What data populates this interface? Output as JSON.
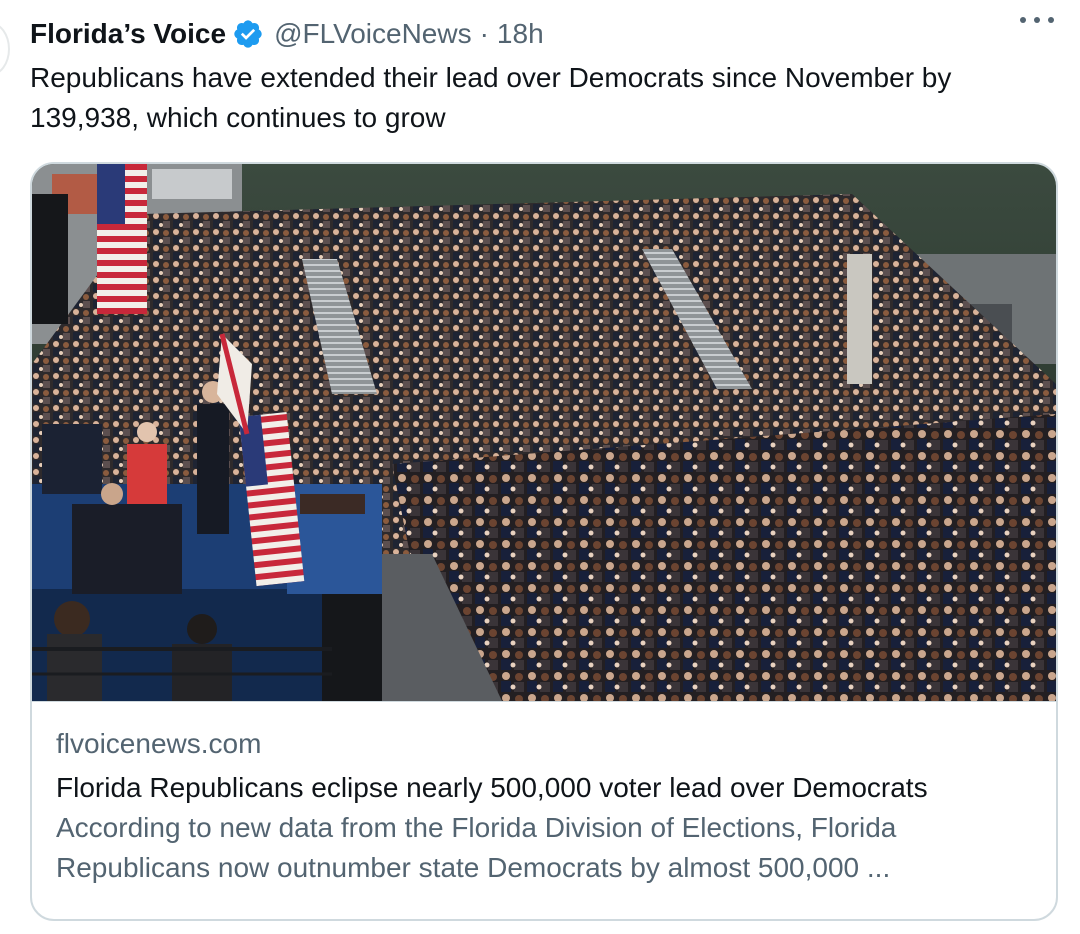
{
  "tweet": {
    "display_name": "Florida’s Voice",
    "handle": "@FLVoiceNews",
    "separator": "·",
    "timestamp": "18h",
    "verified_icon": "verified-badge-icon",
    "text": "Republicans have extended their lead over Democrats since November by 139,938, which continues to grow"
  },
  "link_card": {
    "domain": "flvoicenews.com",
    "title": "Florida Republicans eclipse nearly 500,000 voter lead over Democrats",
    "description": "According to new data from the Florida Division of Elections, Florida Republicans now outnumber state Democrats by almost 500,000 ...",
    "image": "photo of a crowded outdoor rally with speaker at podium and flags"
  },
  "colors": {
    "text_primary": "#0f1419",
    "text_secondary": "#536471",
    "verified_blue": "#1d9bf0",
    "card_border": "#cfd9de"
  }
}
